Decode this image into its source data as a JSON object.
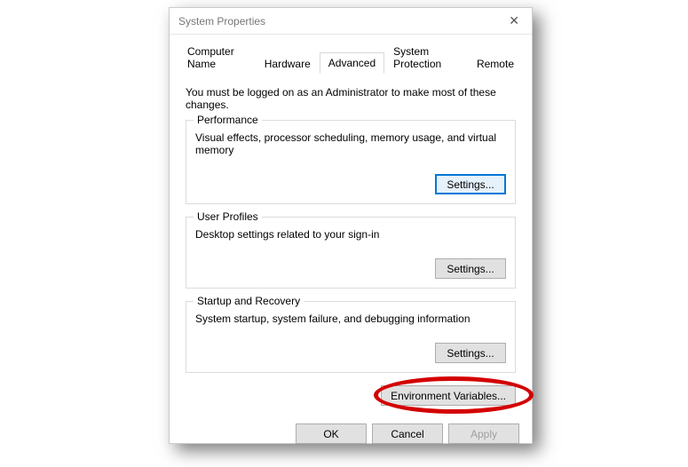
{
  "window": {
    "title": "System Properties"
  },
  "tabs": {
    "computerName": "Computer Name",
    "hardware": "Hardware",
    "advanced": "Advanced",
    "systemProtection": "System Protection",
    "remote": "Remote"
  },
  "intro": "You must be logged on as an Administrator to make most of these changes.",
  "groups": {
    "performance": {
      "label": "Performance",
      "desc": "Visual effects, processor scheduling, memory usage, and virtual memory",
      "button": "Settings..."
    },
    "userProfiles": {
      "label": "User Profiles",
      "desc": "Desktop settings related to your sign-in",
      "button": "Settings..."
    },
    "startupRecovery": {
      "label": "Startup and Recovery",
      "desc": "System startup, system failure, and debugging information",
      "button": "Settings..."
    }
  },
  "envButton": "Environment Variables...",
  "buttons": {
    "ok": "OK",
    "cancel": "Cancel",
    "apply": "Apply"
  }
}
